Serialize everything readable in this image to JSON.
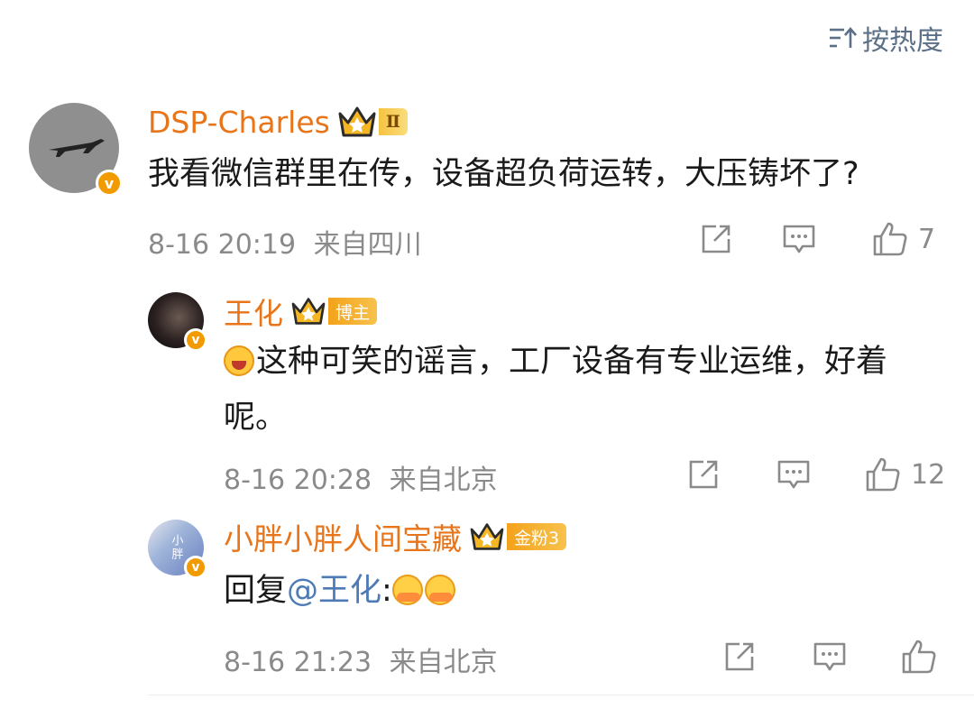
{
  "sort_label": "按热度",
  "comments": [
    {
      "username": "DSP-Charles",
      "level_badge": "Ⅱ",
      "text": "我看微信群里在传，设备超负荷运转，大压铸坏了?",
      "time": "8-16 20:19",
      "source": "来自四川",
      "likes": "7"
    },
    {
      "username": "王化",
      "role_badge": "博主",
      "text": "这种可笑的谣言，工厂设备有专业运维，好着",
      "text_line2": "呢。",
      "time": "8-16 20:28",
      "source": "来自北京",
      "likes": "12"
    },
    {
      "username": "小胖小胖人间宝藏",
      "fan_badge": "金粉3",
      "reply_prefix": "回复",
      "mention": "@王化",
      "reply_suffix": ":",
      "time": "8-16 21:23",
      "source": "来自北京",
      "avatar_text": "小胖"
    }
  ],
  "verified_mark": "v",
  "colors": {
    "username": "#e8751a",
    "mention": "#4e7bb5",
    "meta": "#8a8a8a",
    "verified": "#f29b00"
  }
}
